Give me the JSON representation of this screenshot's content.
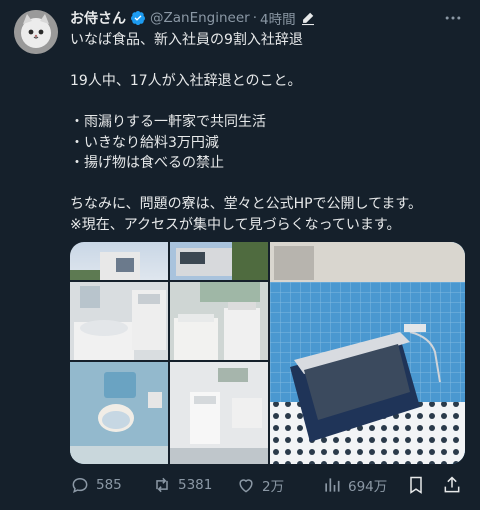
{
  "tweet": {
    "author": {
      "display_name": "お侍さん",
      "handle": "@ZanEngineer",
      "verified": true,
      "avatar_icon": "cat-avatar"
    },
    "time_label": "4時間",
    "separator": "·",
    "lines": [
      "いなば食品、新入社員の9割入社辞退",
      "",
      "19人中、17人が入社辞退とのこと。",
      "",
      "・雨漏りする一軒家で共同生活",
      "・いきなり給料3万円減",
      "・揚げ物は食べるの禁止",
      "",
      "ちなみに、問題の寮は、堂々と公式HPで公開してます。",
      "※現在、アクセスが集中して見づらくなっています。"
    ],
    "metrics": {
      "replies": "585",
      "reposts": "5381",
      "likes": "2万",
      "views": "694万"
    }
  },
  "colors": {
    "background": "#15202b",
    "text": "#e7e9ea",
    "muted": "#8b98a5",
    "verified": "#1d9bf0"
  },
  "icons": [
    "verified-badge-icon",
    "edit-icon",
    "more-icon",
    "reply-icon",
    "repost-icon",
    "like-icon",
    "views-icon",
    "bookmark-icon",
    "share-icon"
  ]
}
